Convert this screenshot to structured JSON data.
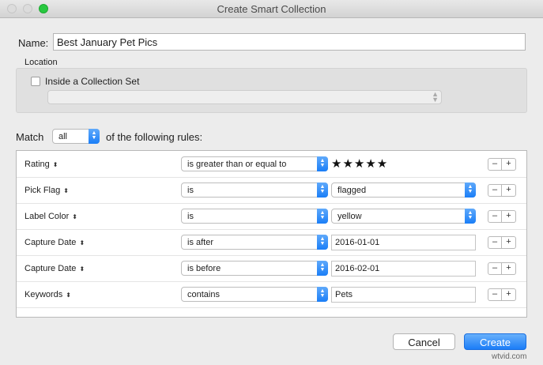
{
  "window": {
    "title": "Create Smart Collection"
  },
  "name": {
    "label": "Name:",
    "value": "Best January Pet Pics"
  },
  "location": {
    "label": "Location",
    "checkbox_label": "Inside a Collection Set",
    "checked": false,
    "select_value": ""
  },
  "match": {
    "label": "Match",
    "value": "all",
    "suffix": "of the following rules:"
  },
  "rules": [
    {
      "field": "Rating",
      "operator": "is greater than or equal to",
      "value_type": "stars",
      "value": "★★★★★",
      "rating": 5
    },
    {
      "field": "Pick Flag",
      "operator": "is",
      "value_type": "select",
      "value": "flagged"
    },
    {
      "field": "Label Color",
      "operator": "is",
      "value_type": "select",
      "value": "yellow"
    },
    {
      "field": "Capture Date",
      "operator": "is after",
      "value_type": "text",
      "value": "2016-01-01"
    },
    {
      "field": "Capture Date",
      "operator": "is before",
      "value_type": "text",
      "value": "2016-02-01"
    },
    {
      "field": "Keywords",
      "operator": "contains",
      "value_type": "text",
      "value": "Pets"
    }
  ],
  "buttons": {
    "minus": "–",
    "plus": "+",
    "cancel": "Cancel",
    "create": "Create"
  },
  "watermark": "wtvid.com",
  "colors": {
    "accent": "#1b7df7",
    "zoom_button": "#28c840"
  }
}
